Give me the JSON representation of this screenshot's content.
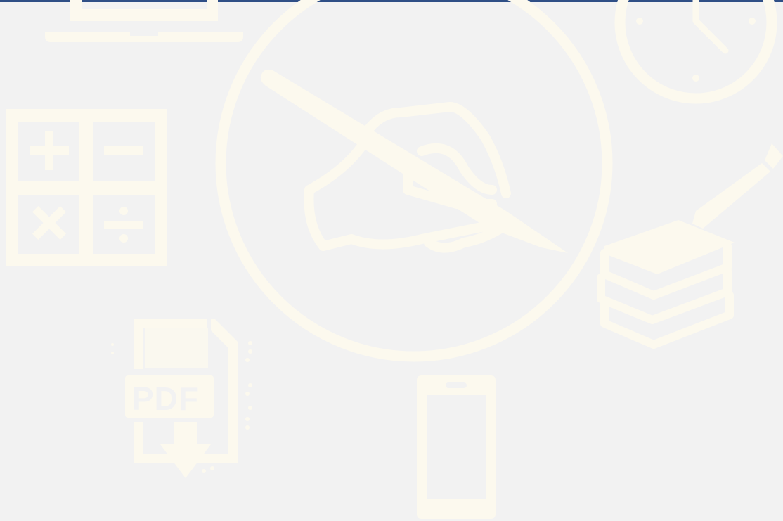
{
  "background": {
    "base_color": "#f2f2f2",
    "icon_color": "#fcf9ee",
    "accent_bar_color": "#2f4f86"
  },
  "icons": [
    "laptop-icon",
    "calculator-icon",
    "pen-writing-hand-icon",
    "clock-icon",
    "books-pencil-icon",
    "pdf-download-icon",
    "smartphone-icon"
  ],
  "pdf_icon": {
    "label": "PDF"
  }
}
